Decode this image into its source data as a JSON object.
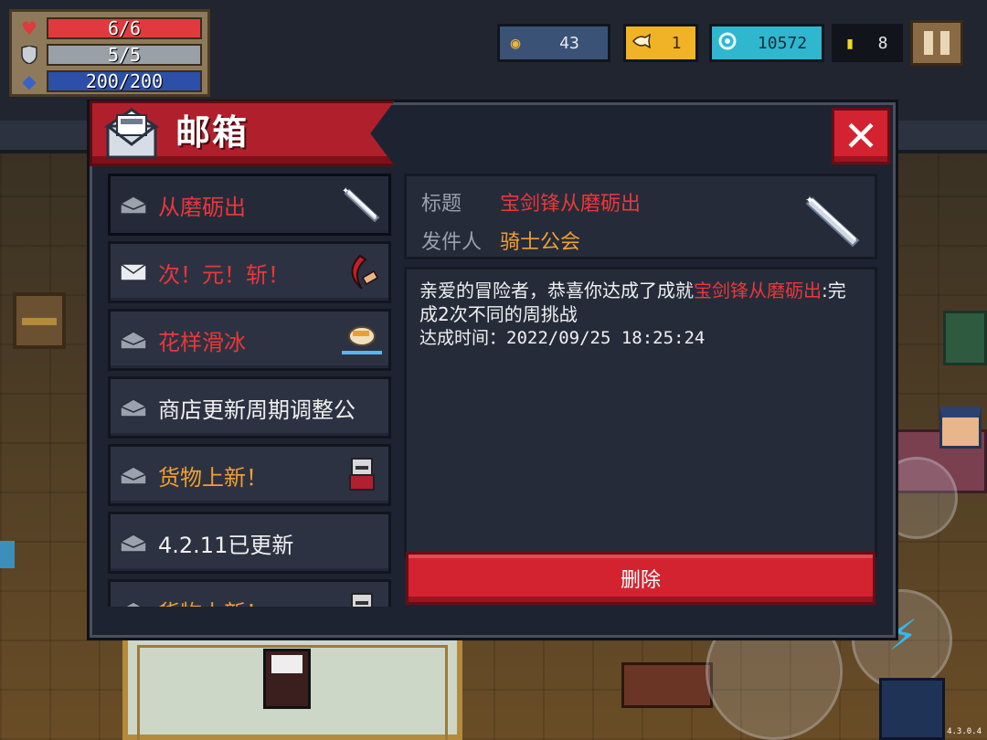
{
  "hud": {
    "health": "6/6",
    "health_fraction": 1.0,
    "armor": "5/5",
    "armor_fraction": 1.0,
    "energy": "200/200",
    "energy_fraction": 1.0,
    "coins": "43",
    "fish": "1",
    "gems": "10572",
    "energy_small": "8",
    "icons": {
      "health": "heart-icon",
      "armor": "shield-icon",
      "energy": "mana-gem-icon",
      "coins": "coin-icon",
      "fish": "fish-icon",
      "gems": "gem-icon",
      "energy_small": "energy-dot-icon",
      "pause": "pause-icon"
    },
    "colors": {
      "health": "#e03a3e",
      "armor": "#9aa0a8",
      "energy": "#2c4fa8"
    }
  },
  "mailbox": {
    "title": "邮箱",
    "close_label": "✕",
    "items": [
      {
        "title": "从磨砺出",
        "color": "red",
        "thumb": "sword-icon",
        "selected": true
      },
      {
        "title": "次！元！斩！",
        "color": "red",
        "thumb": "crescent-blade-icon",
        "selected": false
      },
      {
        "title": "花样滑冰",
        "color": "red",
        "thumb": "skater-icon",
        "selected": false
      },
      {
        "title": "商店更新周期调整公",
        "color": "white",
        "thumb": "",
        "selected": false
      },
      {
        "title": "货物上新！",
        "color": "orange",
        "thumb": "merchant-icon",
        "selected": false
      },
      {
        "title": "4.2.11已更新",
        "color": "white",
        "thumb": "",
        "selected": false
      },
      {
        "title": "货物上新！",
        "color": "orange",
        "thumb": "merchant-icon",
        "selected": false
      }
    ],
    "detail": {
      "subject_label": "标题",
      "subject": "宝剑锋从磨砺出",
      "sender_label": "发件人",
      "sender": "骑士公会",
      "body_prefix": "亲爱的冒险者，恭喜你达成了成就",
      "body_highlight": "宝剑锋从磨砺出",
      "body_suffix": ":完成2次不同的周挑战",
      "time_line": "达成时间：2022/09/25 18:25:24",
      "delete_label": "删除"
    }
  },
  "version": "4.3.0.4"
}
